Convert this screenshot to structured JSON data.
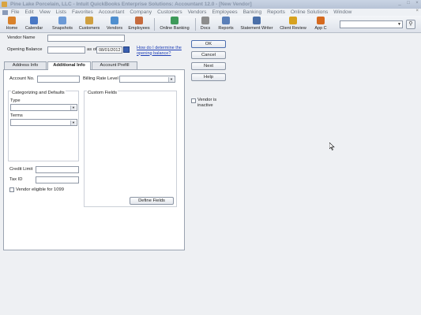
{
  "window": {
    "title": "Pine Lake Porcelain, LLC - Intuit QuickBooks Enterprise Solutions: Accountant 12.0 - [New Vendor]",
    "controls": [
      "_",
      "□",
      "×"
    ]
  },
  "menu": {
    "items": [
      "File",
      "Edit",
      "View",
      "Lists",
      "Favorites",
      "Accountant",
      "Company",
      "Customers",
      "Vendors",
      "Employees",
      "Banking",
      "Reports",
      "Online Solutions",
      "Window"
    ],
    "close": "×"
  },
  "toolbar": {
    "items": [
      {
        "label": "Home",
        "icon": "home-icon",
        "color": "#d9822b"
      },
      {
        "label": "Calendar",
        "icon": "calendar-icon",
        "color": "#4a78c4"
      },
      {
        "label": "Snapshots",
        "icon": "snapshots-icon",
        "color": "#6c9ad6"
      },
      {
        "label": "Customers",
        "icon": "customers-icon",
        "color": "#d0a040"
      },
      {
        "label": "Vendors",
        "icon": "vendors-icon",
        "color": "#4f8fcf"
      },
      {
        "label": "Employees",
        "icon": "employees-icon",
        "color": "#c66b3d"
      },
      {
        "label": "Online Banking",
        "icon": "online-banking-icon",
        "color": "#3e9a5a"
      },
      {
        "label": "Docs",
        "icon": "docs-icon",
        "color": "#8d8d8d"
      },
      {
        "label": "Reports",
        "icon": "reports-icon",
        "color": "#5a7fb8"
      },
      {
        "label": "Statement Writer",
        "icon": "statement-writer-icon",
        "color": "#4a6fa8"
      },
      {
        "label": "Client Review",
        "icon": "client-review-icon",
        "color": "#d7a21f"
      },
      {
        "label": "App C",
        "icon": "app-center-icon",
        "color": "#d66a1f"
      }
    ],
    "search_value": ""
  },
  "vendor": {
    "name_label": "Vendor Name",
    "name_value": "",
    "opening_balance_label": "Opening Balance",
    "opening_balance_value": "",
    "as_of_label": "as of",
    "as_of_value": "08/01/2012",
    "help_link": "How do I determine the opening balance?"
  },
  "tabs": [
    {
      "label": "Address Info",
      "active": false
    },
    {
      "label": "Additional Info",
      "active": true
    },
    {
      "label": "Account Prefill",
      "active": false
    }
  ],
  "additional": {
    "account_no_label": "Account No.",
    "account_no_value": "",
    "billing_rate_label": "Billing Rate Level",
    "billing_rate_value": "",
    "categorizing_title": "Categorizing and Defaults",
    "type_label": "Type",
    "type_value": "",
    "terms_label": "Terms",
    "terms_value": "",
    "custom_fields_title": "Custom Fields",
    "credit_limit_label": "Credit Limit",
    "credit_limit_value": "",
    "tax_id_label": "Tax ID",
    "tax_id_value": "",
    "eligible_1099_label": "Vendor eligible for 1099",
    "eligible_1099_checked": false,
    "define_fields_label": "Define Fields"
  },
  "actions": {
    "ok": "OK",
    "cancel": "Cancel",
    "next": "Next",
    "help": "Help",
    "inactive_label": "Vendor is inactive",
    "inactive_checked": false
  }
}
